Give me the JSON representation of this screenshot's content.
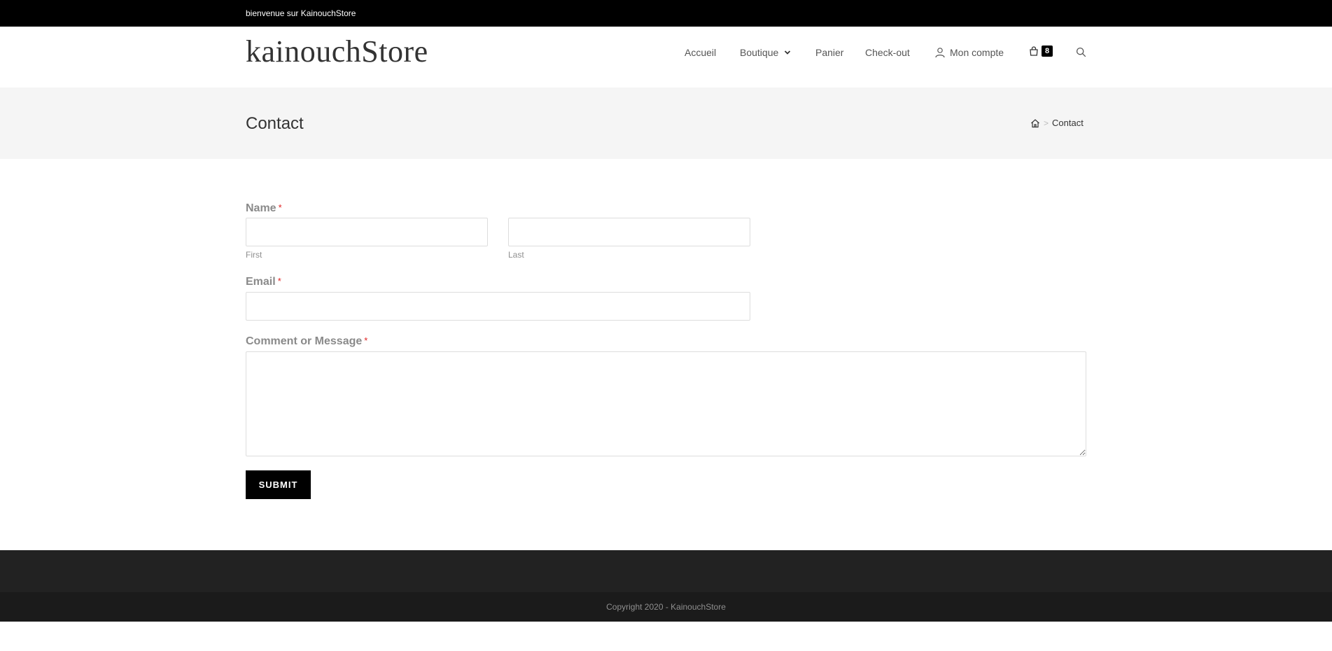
{
  "topbar": {
    "text": "bienvenue sur KainouchStore"
  },
  "header": {
    "logo": "kainouchStore",
    "nav": {
      "accueil": "Accueil",
      "boutique": "Boutique",
      "panier": "Panier",
      "checkout": "Check-out",
      "compte": "Mon compte"
    },
    "cart_count": "8"
  },
  "page_header": {
    "title": "Contact",
    "breadcrumb": {
      "current": "Contact"
    }
  },
  "form": {
    "name": {
      "label": "Name",
      "required": "*",
      "first": "First",
      "last": "Last"
    },
    "email": {
      "label": "Email",
      "required": "*"
    },
    "message": {
      "label": "Comment or Message",
      "required": "*"
    },
    "submit": "SUBMIT"
  },
  "footer": {
    "copyright": "Copyright 2020 - KainouchStore"
  },
  "colors": {
    "topbar": "#000000",
    "accent": "#000000",
    "footer": "#222222",
    "footer_bottom": "#1b1b1b",
    "required": "#e02424"
  },
  "icons": [
    "chevron-down-icon",
    "user-icon",
    "shopping-bag-icon",
    "search-icon",
    "home-icon"
  ]
}
